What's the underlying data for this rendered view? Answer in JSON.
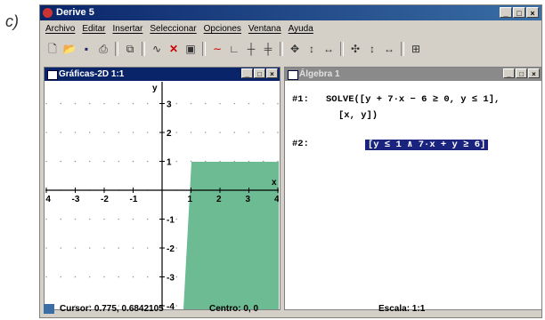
{
  "label": "c)",
  "app": {
    "title": "Derive 5"
  },
  "menu": [
    "Archivo",
    "Editar",
    "Insertar",
    "Seleccionar",
    "Opciones",
    "Ventana",
    "Ayuda"
  ],
  "toolbar_icons": [
    "new-icon",
    "open-icon",
    "save-icon",
    "print-icon",
    "copy-icon",
    "approximate-icon",
    "delete-icon",
    "window-icon",
    "plot-icon",
    "axes-icon",
    "grid-icon",
    "grid2-icon",
    "move-icon",
    "vertical-icon",
    "horizontal-icon",
    "zoom-icon",
    "zoom-vertical-icon",
    "zoom-horizontal-icon",
    "table-icon"
  ],
  "graph_window": {
    "title": "Gráficas-2D 1:1",
    "x_axis_label": "x",
    "y_axis_label": "y",
    "x_ticks": [
      "-4",
      "-3",
      "-2",
      "-1",
      "1",
      "2",
      "3",
      "4"
    ],
    "y_ticks": [
      "3",
      "2",
      "1",
      "-1",
      "-2",
      "-3",
      "-4"
    ]
  },
  "algebra_window": {
    "title": "Álgebra 1",
    "line1_label": "#1:",
    "line1_expr": "SOLVE([y + 7·x − 6 ≥ 0, y ≤ 1],",
    "line1_cont": "[x, y])",
    "line2_label": "#2:",
    "line2_result": "[y ≤ 1 ∧ 7·x + y ≥ 6]"
  },
  "status": {
    "cursor": "Cursor: 0.775, 0.6842105",
    "centro": "Centro: 0, 0",
    "escala": "Escala: 1:1"
  },
  "colors": {
    "region": "#6dbb93",
    "titlebar": "#0a246a",
    "highlight": "#1a237e"
  }
}
